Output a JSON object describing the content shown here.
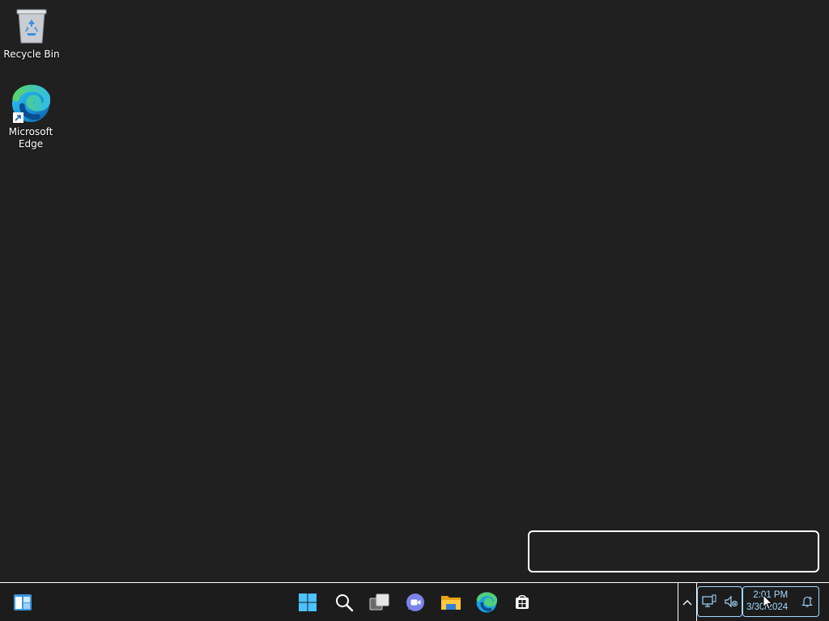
{
  "desktop": {
    "icons": [
      {
        "label": "Recycle Bin",
        "icon": "recycle-bin-icon"
      },
      {
        "label": "Microsoft Edge",
        "icon": "edge-icon"
      }
    ]
  },
  "taskbar": {
    "widgets_icon": "widgets-icon",
    "start_icon": "windows-start-icon",
    "search_icon": "search-icon",
    "task_view_icon": "task-view-icon",
    "chat_icon": "teams-chat-icon",
    "file_explorer_icon": "file-explorer-icon",
    "edge_icon": "edge-icon",
    "store_icon": "microsoft-store-icon"
  },
  "tray": {
    "chevron_icon": "show-hidden-icons-chevron",
    "network_icon": "network-icon",
    "volume_icon": "volume-muted-icon",
    "time": "2:01 PM",
    "date": "3/30/2024",
    "notification_icon": "notification-bell-icon"
  },
  "colors": {
    "desktop_bg": "#202020",
    "taskbar_bg": "#1c1c1c",
    "accent": "#9fd8ff"
  }
}
